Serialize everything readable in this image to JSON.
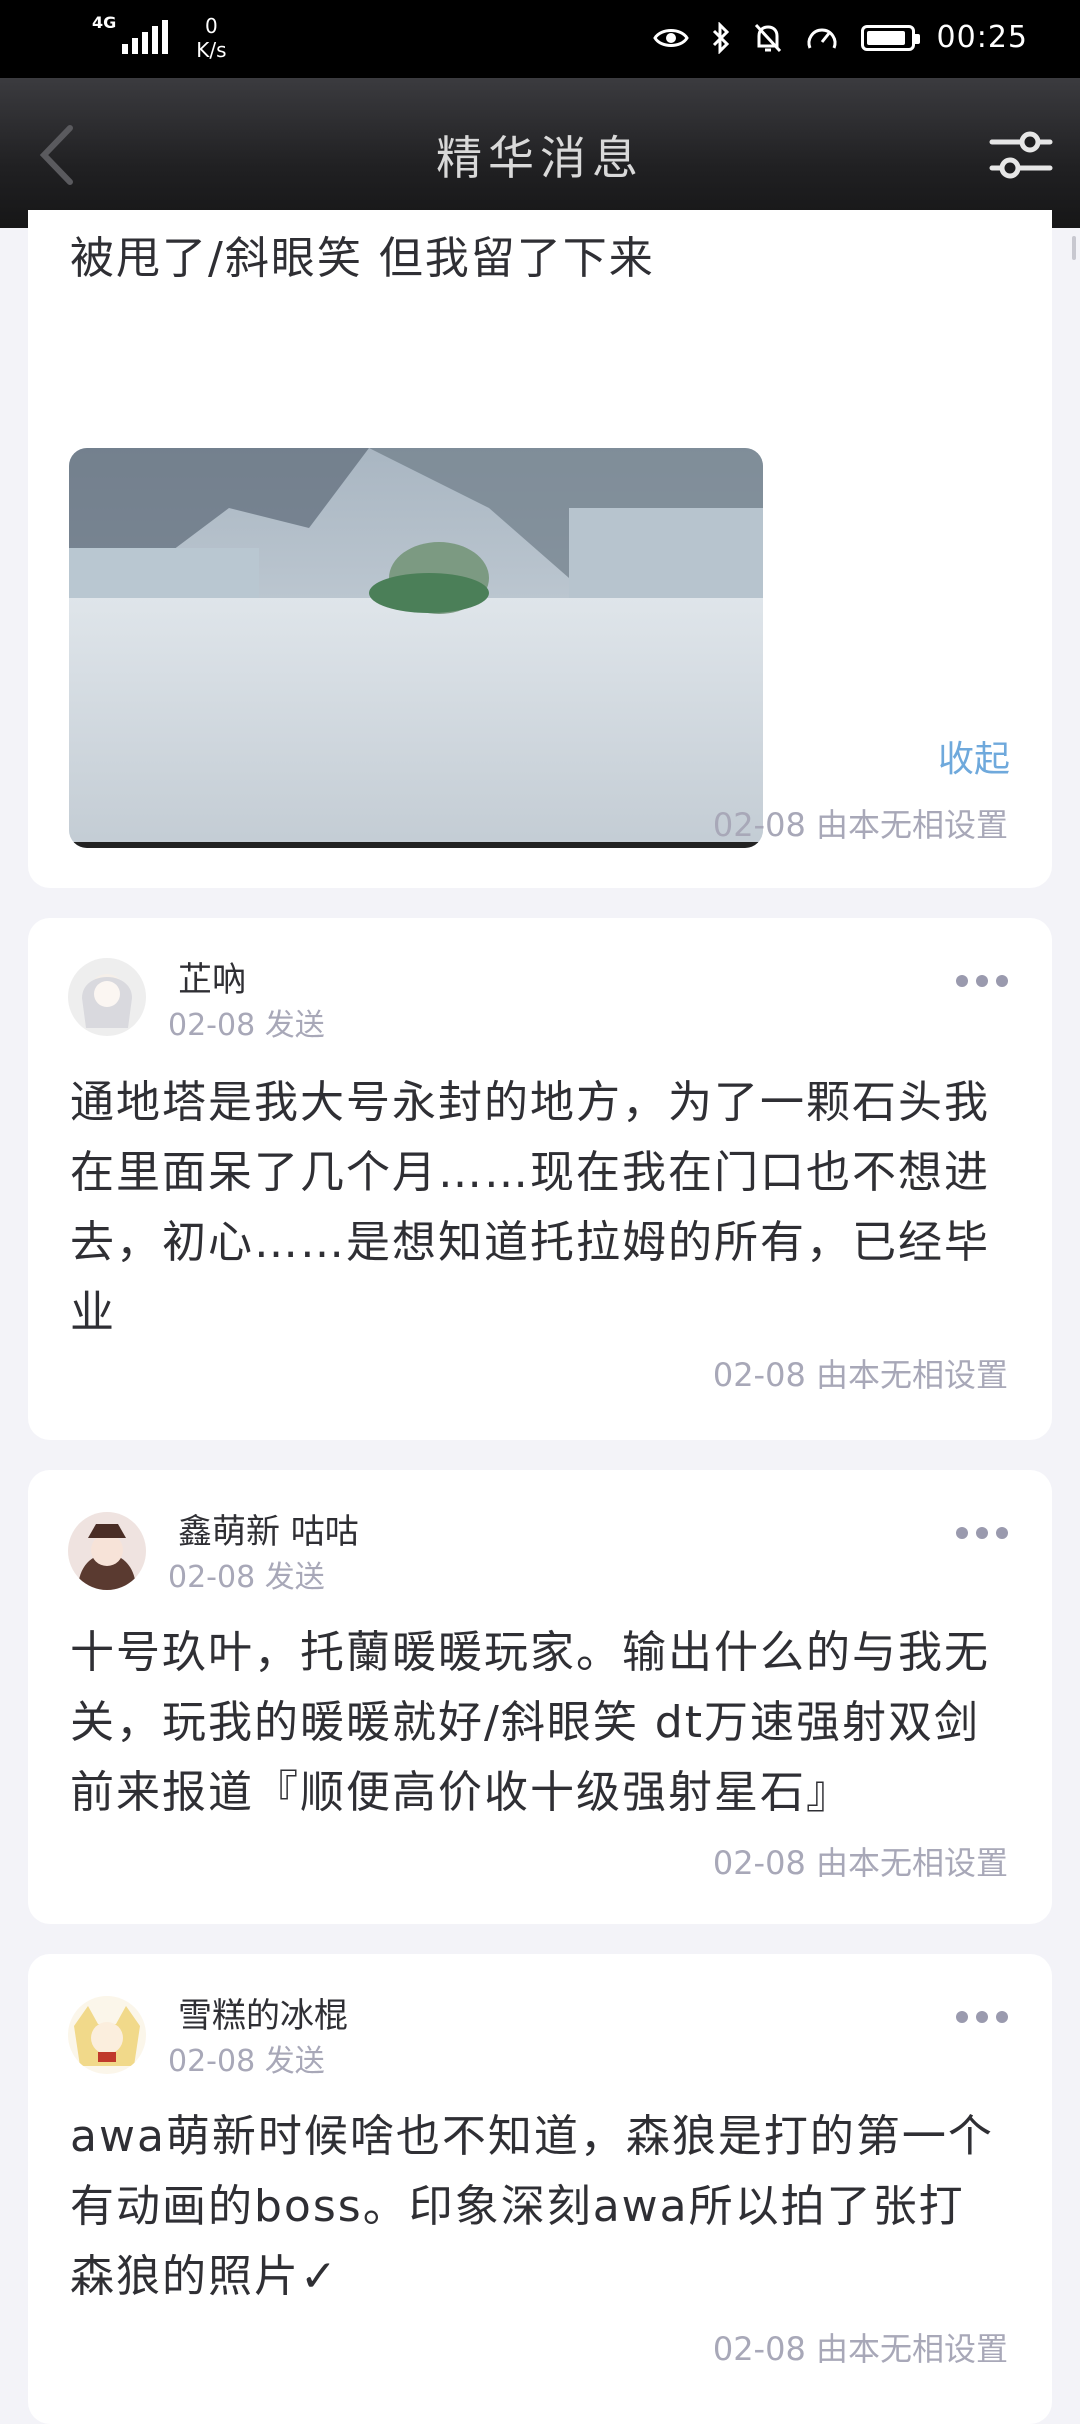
{
  "status_bar": {
    "network_type": "4G",
    "speed_value": "0",
    "speed_unit": "K/s",
    "time": "00:25",
    "icons": [
      "eye-icon",
      "bluetooth-icon",
      "mute-icon",
      "gauge-icon",
      "battery-icon"
    ],
    "battery_level": 0.9
  },
  "nav": {
    "title": "精华消息",
    "back_icon": "back-chevron-icon",
    "settings_icon": "settings-sliders-icon"
  },
  "posts": [
    {
      "partial": true,
      "text": "被甩了/斜眼笑 但我留了下来",
      "collapse_label": "收起",
      "set_info": "02-08 由本无相设置"
    },
    {
      "username": "芷吶",
      "sent": "02-08 发送",
      "text": "通地塔是我大号永封的地方，为了一颗石头我在里面呆了几个月……现在我在门口也不想进去，初心……是想知道托拉姆的所有，已经毕业",
      "set_info": "02-08 由本无相设置"
    },
    {
      "username": "鑫萌新 咕咕",
      "sent": "02-08 发送",
      "text": "十号玖叶，托蘭暖暖玩家。输出什么的与我无关，玩我的暖暖就好/斜眼笑 dt万速强射双剑前来报道『顺便高价收十级强射星石』",
      "set_info": "02-08 由本无相设置"
    },
    {
      "username": "雪糕的冰棍",
      "sent": "02-08 发送",
      "text": "awa萌新时候啥也不知道，森狼是打的第一个有动画的boss。印象深刻awa所以拍了张打森狼的照片✓",
      "set_info": "02-08 由本无相设置"
    }
  ],
  "colors": {
    "page_bg": "#f3f3f8",
    "card_bg": "#ffffff",
    "text": "#2f2f34",
    "meta": "#a8a8b8",
    "link": "#6fa9dc"
  }
}
